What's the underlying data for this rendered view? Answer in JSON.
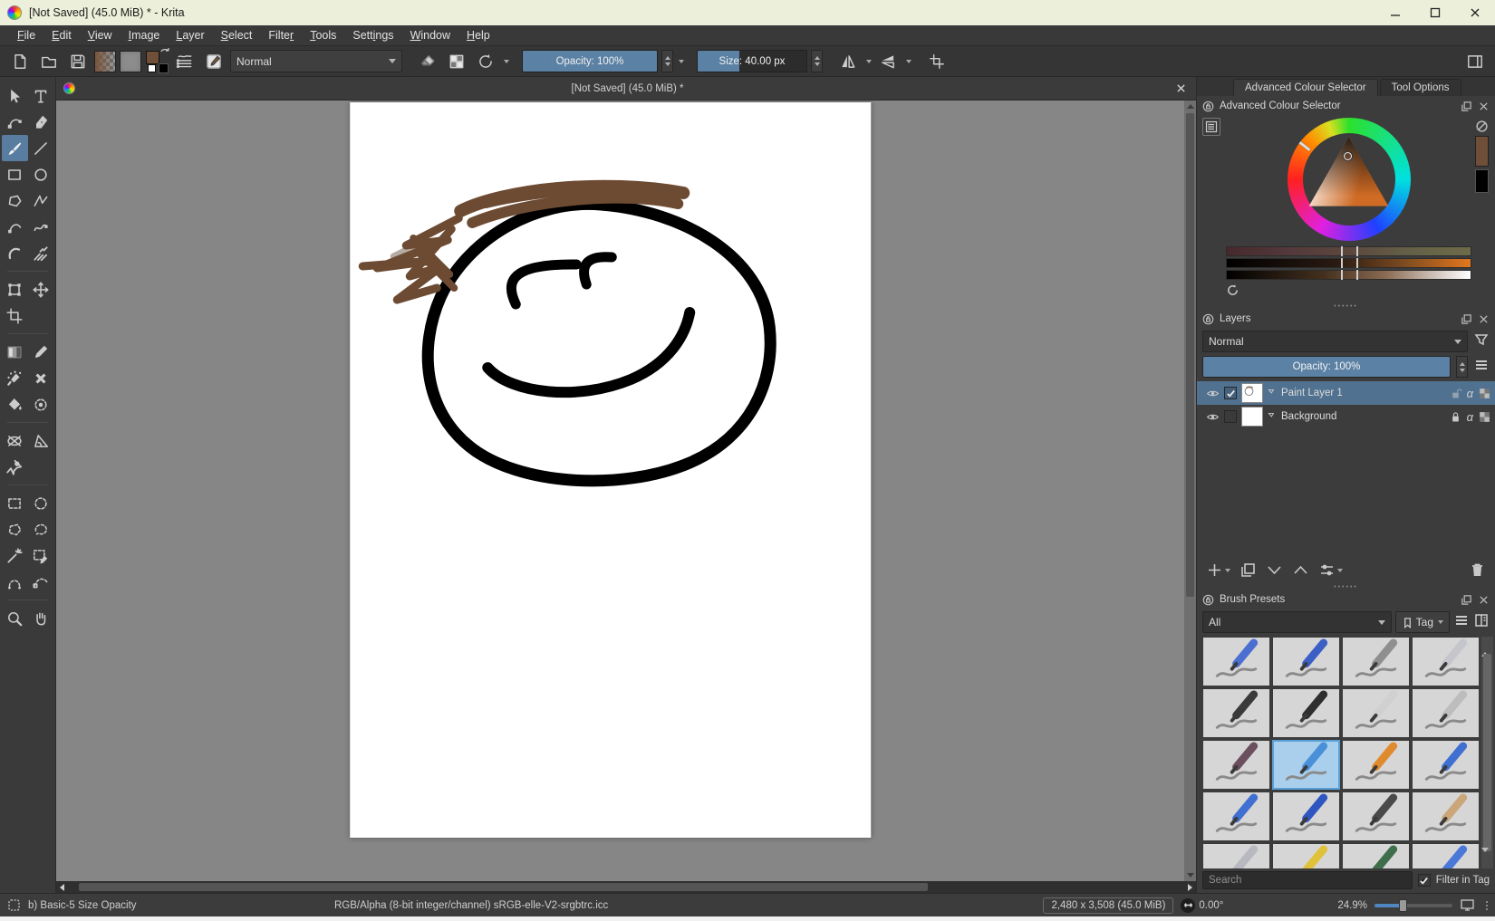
{
  "window": {
    "title": "[Not Saved]  (45.0 MiB) * - Krita"
  },
  "menu": {
    "items": [
      {
        "label": "File",
        "m": 0
      },
      {
        "label": "Edit",
        "m": 0
      },
      {
        "label": "View",
        "m": 0
      },
      {
        "label": "Image",
        "m": 0
      },
      {
        "label": "Layer",
        "m": 0
      },
      {
        "label": "Select",
        "m": 0
      },
      {
        "label": "Filter",
        "m": 5
      },
      {
        "label": "Tools",
        "m": 0
      },
      {
        "label": "Settings",
        "m": 4
      },
      {
        "label": "Window",
        "m": 0
      },
      {
        "label": "Help",
        "m": 0
      }
    ]
  },
  "toolbar": {
    "blend_mode": "Normal",
    "opacity_label": "Opacity: 100%",
    "size_label": "Size: 40.00 px"
  },
  "canvas": {
    "tab_title": "[Not Saved]  (45.0 MiB) *"
  },
  "left_tools": {
    "groups": [
      [
        {
          "name": "select-shapes"
        },
        {
          "name": "text"
        },
        {
          "name": "edit-shapes"
        },
        {
          "name": "calligraphy"
        },
        {
          "name": "freehand-brush",
          "selected": true
        },
        {
          "name": "line"
        },
        {
          "name": "rectangle"
        },
        {
          "name": "ellipse"
        },
        {
          "name": "polygon"
        },
        {
          "name": "polyline"
        },
        {
          "name": "bezier-curve"
        },
        {
          "name": "freehand-path"
        },
        {
          "name": "dynamic-brush"
        },
        {
          "name": "multibrush"
        }
      ],
      [
        {
          "name": "transform"
        },
        {
          "name": "move"
        },
        {
          "name": "crop"
        }
      ],
      [
        {
          "name": "gradient"
        },
        {
          "name": "color-sampler"
        },
        {
          "name": "coloring-brush"
        },
        {
          "name": "smart-patch"
        },
        {
          "name": "fill"
        },
        {
          "name": "enclose-fill"
        }
      ],
      [
        {
          "name": "assistants"
        },
        {
          "name": "measure"
        },
        {
          "name": "reference-images"
        }
      ],
      [
        {
          "name": "rect-select"
        },
        {
          "name": "ellipse-select"
        },
        {
          "name": "polygon-select"
        },
        {
          "name": "freehand-select"
        },
        {
          "name": "similar-select"
        },
        {
          "name": "select-by-color"
        },
        {
          "name": "magnetic-select"
        },
        {
          "name": "bezier-select"
        }
      ],
      [
        {
          "name": "zoom"
        },
        {
          "name": "pan"
        }
      ]
    ]
  },
  "right": {
    "tabs": [
      {
        "label": "Advanced Colour Selector",
        "active": true
      },
      {
        "label": "Tool Options",
        "active": false
      }
    ],
    "color_selector": {
      "title": "Advanced Colour Selector"
    },
    "layers": {
      "title": "Layers",
      "blend_mode": "Normal",
      "opacity_label": "Opacity:  100%",
      "alpha_glyph": "α",
      "rows": [
        {
          "name": "Paint Layer 1",
          "selected": true,
          "checked": true,
          "locked": false,
          "thumb": "sketch"
        },
        {
          "name": "Background",
          "selected": false,
          "checked": false,
          "locked": true,
          "thumb": "white"
        }
      ]
    },
    "brush_presets": {
      "title": "Brush Presets",
      "filter_value": "All",
      "tag_label": "Tag",
      "search_placeholder": "Search",
      "filter_in_tag_label": "Filter in Tag",
      "tiles": [
        {
          "c": "#4a6fd0"
        },
        {
          "c": "#3b5fc4"
        },
        {
          "c": "#8f8f8f"
        },
        {
          "c": "#c5c5cc"
        },
        {
          "c": "#3a3a3a"
        },
        {
          "c": "#2e2e2e"
        },
        {
          "c": "#d0d0d0"
        },
        {
          "c": "#bdbdbd"
        },
        {
          "c": "#6b4f5f"
        },
        {
          "c": "#4a90d9",
          "selected": true
        },
        {
          "c": "#e08a2e"
        },
        {
          "c": "#3f6fd0"
        },
        {
          "c": "#3f6fd0"
        },
        {
          "c": "#2f55c0"
        },
        {
          "c": "#4a4a4a"
        },
        {
          "c": "#caa67a"
        },
        {
          "c": "#b8b8c0"
        },
        {
          "c": "#e0c23a"
        },
        {
          "c": "#3f6f4a"
        },
        {
          "c": "#4a78d8"
        }
      ]
    }
  },
  "status": {
    "brush": "b) Basic-5 Size Opacity",
    "colorspace": "RGB/Alpha (8-bit integer/channel)  sRGB-elle-V2-srgbtrc.icc",
    "dims": "2,480 x 3,508 (45.0 MiB)",
    "angle": "0.00°",
    "zoom": "24.9%"
  },
  "accent": {
    "slider_blue": "#5b81a4",
    "selection_blue": "#50718f",
    "fg_color": "#6f4f38"
  }
}
